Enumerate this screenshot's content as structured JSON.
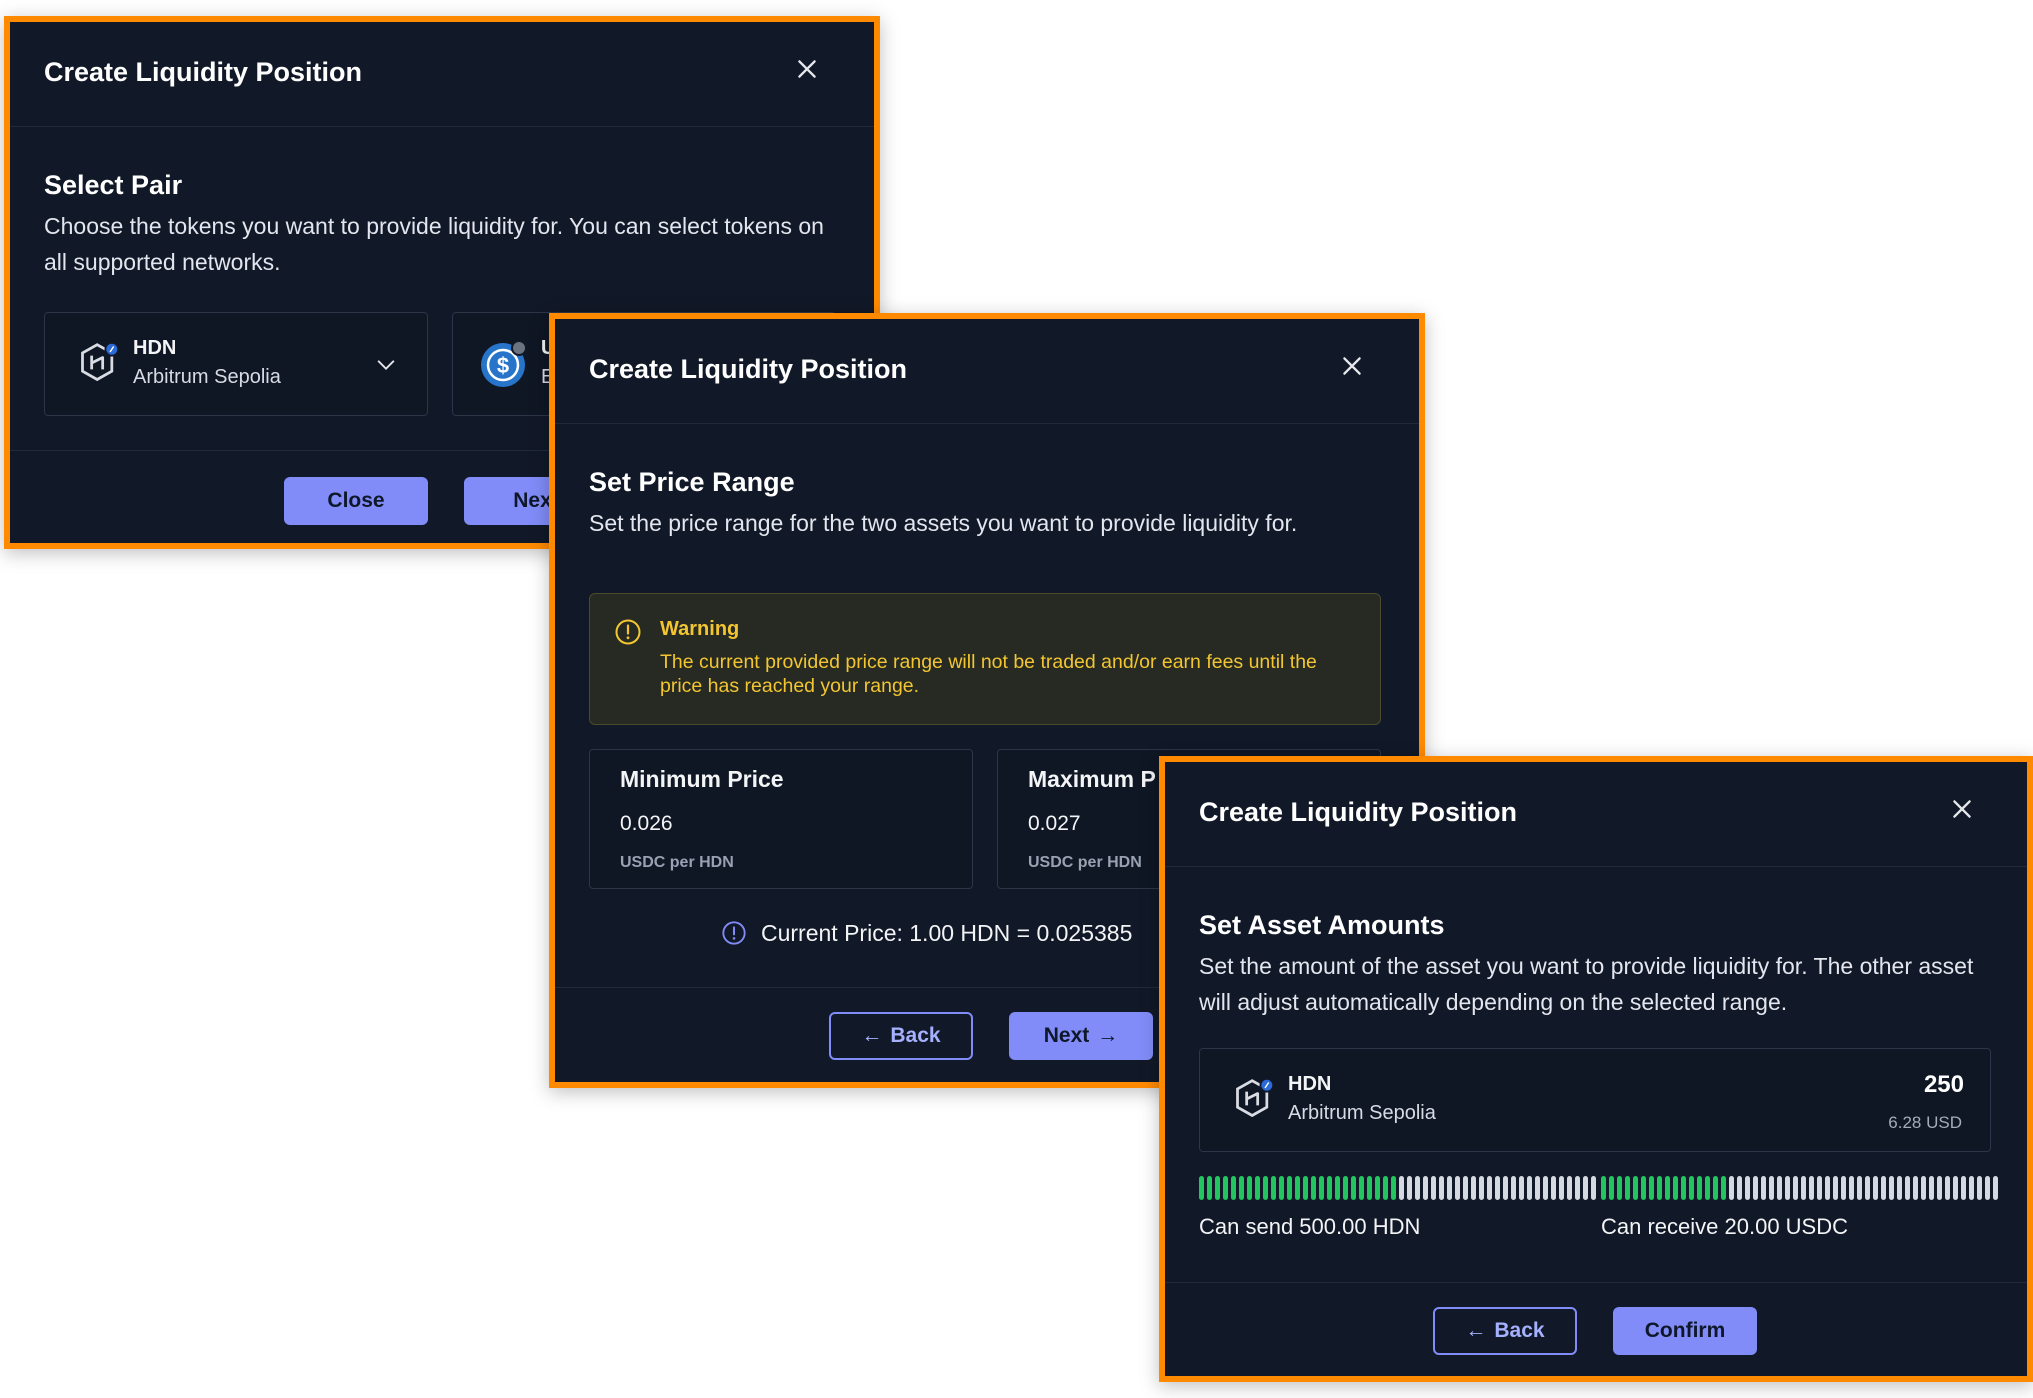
{
  "modal_select_pair": {
    "title": "Create Liquidity Position",
    "section_title": "Select Pair",
    "section_desc": "Choose the tokens you want to provide liquidity for. You can select tokens on all supported networks.",
    "token_a": {
      "symbol": "HDN",
      "network": "Arbitrum Sepolia"
    },
    "token_b": {
      "symbol": "U",
      "network": "E"
    },
    "close_label": "Close",
    "next_label": "Next"
  },
  "modal_price_range": {
    "title": "Create Liquidity Position",
    "section_title": "Set Price Range",
    "section_desc": "Set the price range for the two assets you want to provide liquidity for.",
    "warning": {
      "title": "Warning",
      "text": "The current provided price range will not be traded and/or earn fees until the price has reached your range."
    },
    "min_price": {
      "label": "Minimum Price",
      "value": "0.026",
      "unit": "USDC per HDN"
    },
    "max_price": {
      "label": "Maximum P",
      "value": "0.027",
      "unit": "USDC per HDN"
    },
    "current_price": "Current Price: 1.00 HDN = 0.025385",
    "back_label": "Back",
    "next_label": "Next"
  },
  "modal_asset_amounts": {
    "title": "Create Liquidity Position",
    "section_title": "Set Asset Amounts",
    "section_desc": "Set the amount of the asset you want to provide liquidity for. The other asset will adjust automatically depending on the selected range.",
    "token": {
      "symbol": "HDN",
      "network": "Arbitrum Sepolia",
      "amount": "250",
      "usd_value": "6.28 USD"
    },
    "send_level": 0.5,
    "receive_level": 0.32,
    "send_caption": "Can send 500.00 HDN",
    "receive_caption": "Can receive 20.00 USDC",
    "back_label": "Back",
    "confirm_label": "Confirm"
  },
  "colors": {
    "modal_bg": "#111827",
    "border_highlight": "#ff8a00",
    "accent": "#818cf8",
    "warning": "#f2c531",
    "bar_filled": "#22c55e",
    "bar_empty": "#d5d9e2"
  },
  "icons": {
    "close": "close-icon",
    "chevron": "chevron-down-icon",
    "hdn": "hdn-token-icon",
    "usdc": "usdc-token-icon",
    "warning": "warning-circle-icon",
    "info": "info-circle-icon",
    "back_arrow": "arrow-left-icon",
    "next_arrow": "arrow-right-icon"
  }
}
